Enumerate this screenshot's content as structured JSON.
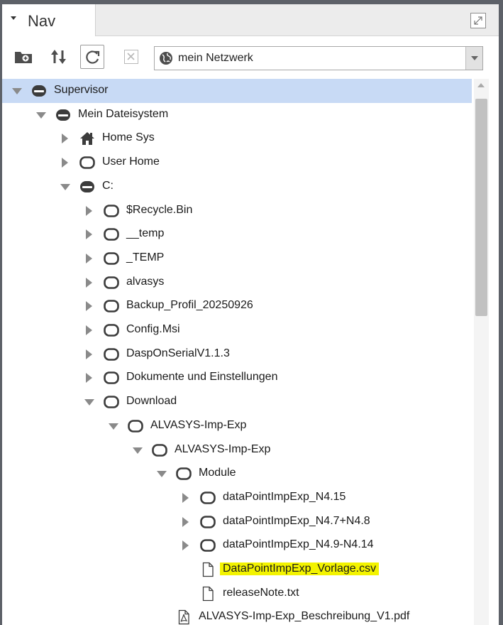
{
  "nav": {
    "tab_title": "Nav",
    "location_select_value": "mein Netzwerk"
  },
  "tree": [
    {
      "depth": 0,
      "toggle": "expanded",
      "icon": "drive-icon",
      "label": "Supervisor",
      "selected": true
    },
    {
      "depth": 1,
      "toggle": "expanded",
      "icon": "drive-icon",
      "label": "Mein Dateisystem"
    },
    {
      "depth": 2,
      "toggle": "collapsed",
      "icon": "home-icon",
      "label": "Home Sys"
    },
    {
      "depth": 2,
      "toggle": "collapsed",
      "icon": "folder-icon",
      "label": "User Home"
    },
    {
      "depth": 2,
      "toggle": "expanded",
      "icon": "drive-icon",
      "label": "C:"
    },
    {
      "depth": 3,
      "toggle": "collapsed",
      "icon": "folder-icon",
      "label": "$Recycle.Bin"
    },
    {
      "depth": 3,
      "toggle": "collapsed",
      "icon": "folder-icon",
      "label": "__temp"
    },
    {
      "depth": 3,
      "toggle": "collapsed",
      "icon": "folder-icon",
      "label": "_TEMP"
    },
    {
      "depth": 3,
      "toggle": "collapsed",
      "icon": "folder-icon",
      "label": "alvasys"
    },
    {
      "depth": 3,
      "toggle": "collapsed",
      "icon": "folder-icon",
      "label": "Backup_Profil_20250926"
    },
    {
      "depth": 3,
      "toggle": "collapsed",
      "icon": "folder-icon",
      "label": "Config.Msi"
    },
    {
      "depth": 3,
      "toggle": "collapsed",
      "icon": "folder-icon",
      "label": "DaspOnSerialV1.1.3"
    },
    {
      "depth": 3,
      "toggle": "collapsed",
      "icon": "folder-icon",
      "label": "Dokumente und Einstellungen"
    },
    {
      "depth": 3,
      "toggle": "expanded",
      "icon": "folder-icon",
      "label": "Download"
    },
    {
      "depth": 4,
      "toggle": "expanded",
      "icon": "folder-icon",
      "label": "ALVASYS-Imp-Exp"
    },
    {
      "depth": 5,
      "toggle": "expanded",
      "icon": "folder-icon",
      "label": "ALVASYS-Imp-Exp"
    },
    {
      "depth": 6,
      "toggle": "expanded",
      "icon": "folder-icon",
      "label": "Module"
    },
    {
      "depth": 7,
      "toggle": "collapsed",
      "icon": "folder-icon",
      "label": "dataPointImpExp_N4.15"
    },
    {
      "depth": 7,
      "toggle": "collapsed",
      "icon": "folder-icon",
      "label": "dataPointImpExp_N4.7+N4.8"
    },
    {
      "depth": 7,
      "toggle": "collapsed",
      "icon": "folder-icon",
      "label": "dataPointImpExp_N4.9-N4.14"
    },
    {
      "depth": 7,
      "toggle": "none",
      "icon": "file-icon",
      "label": "DataPointImpExp_Vorlage.csv",
      "highlight": true
    },
    {
      "depth": 7,
      "toggle": "none",
      "icon": "file-icon",
      "label": "releaseNote.txt"
    },
    {
      "depth": 6,
      "toggle": "none",
      "icon": "pdf-file-icon",
      "label": "ALVASYS-Imp-Exp_Beschreibung_V1.pdf"
    }
  ],
  "colors": {
    "selection": "#c8daf5",
    "highlight": "#f3f300",
    "icon": "#3c3c3c",
    "toggle": "#8a8a8a"
  }
}
